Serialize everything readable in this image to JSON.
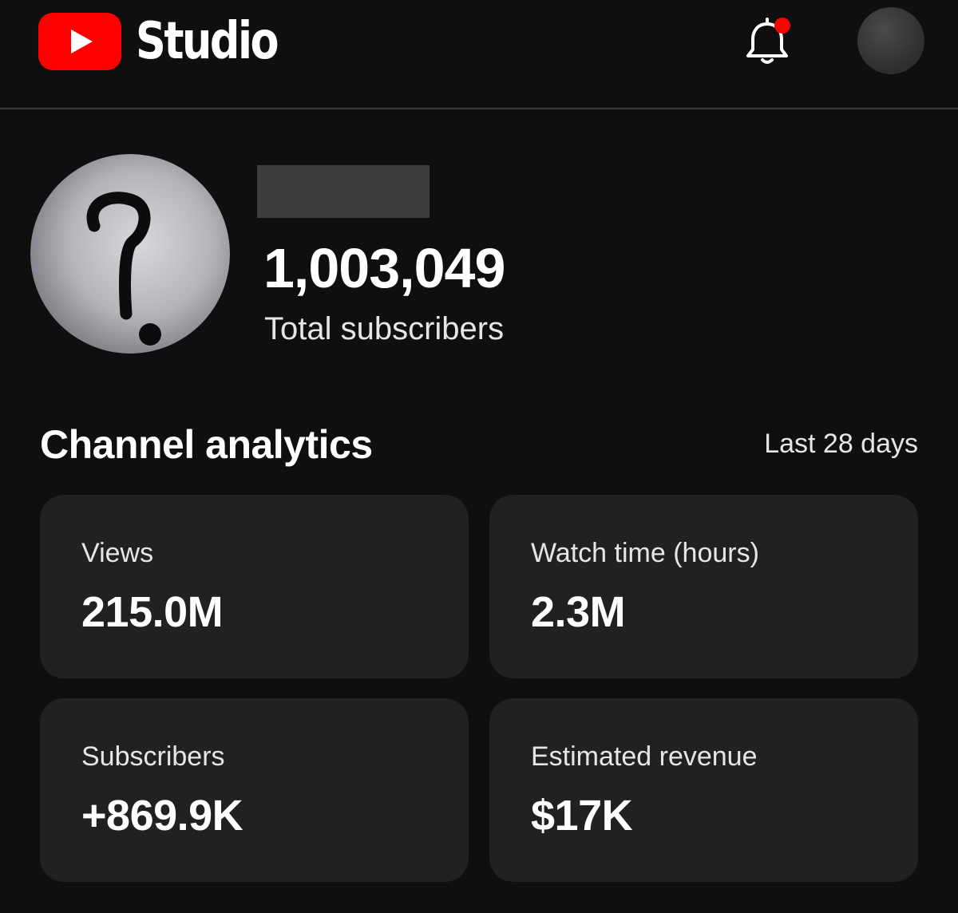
{
  "header": {
    "app_title": "Studio",
    "logo_icon": "youtube-play-logo",
    "notification_icon": "bell-icon",
    "notification_dot_color": "#ff0000",
    "brand_color": "#ff0000"
  },
  "channel": {
    "subscriber_count": "1,003,049",
    "subscriber_label": "Total subscribers"
  },
  "analytics": {
    "title": "Channel analytics",
    "period": "Last 28 days",
    "cards": [
      {
        "label": "Views",
        "value": "215.0M"
      },
      {
        "label": "Watch time (hours)",
        "value": "2.3M"
      },
      {
        "label": "Subscribers",
        "value": "+869.9K"
      },
      {
        "label": "Estimated revenue",
        "value": "$17K"
      }
    ]
  }
}
